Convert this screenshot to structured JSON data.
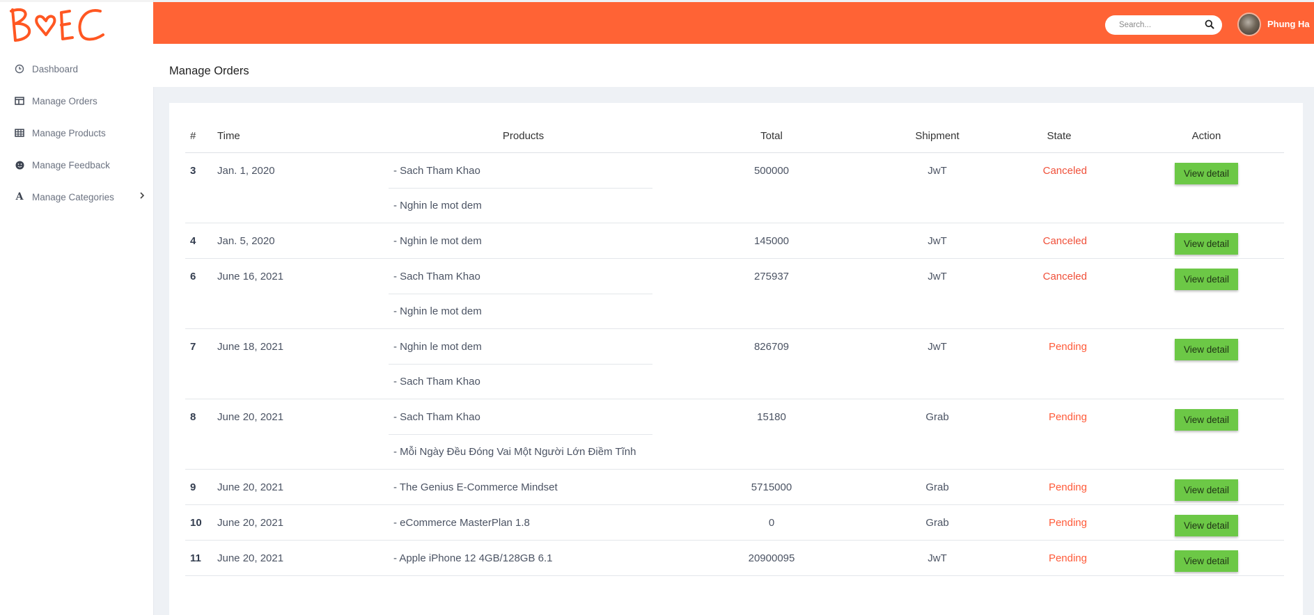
{
  "app": {
    "logo_text": "BoEC"
  },
  "sidebar": {
    "items": [
      {
        "label": "Dashboard",
        "icon": "clock-icon"
      },
      {
        "label": "Manage Orders",
        "icon": "columns-icon"
      },
      {
        "label": "Manage Products",
        "icon": "grid-icon"
      },
      {
        "label": "Manage Feedback",
        "icon": "smile-icon"
      },
      {
        "label": "Manage Categories",
        "icon": "letter-a-icon",
        "has_submenu": true
      }
    ]
  },
  "header": {
    "search_placeholder": "Search...",
    "username": "Phung Ha",
    "background_color": "#ff6335"
  },
  "page": {
    "title": "Manage Orders"
  },
  "table": {
    "columns": [
      "#",
      "Time",
      "Products",
      "Total",
      "Shipment",
      "State",
      "Action"
    ],
    "rows": [
      {
        "id": "3",
        "time": "Jan. 1, 2020",
        "products": [
          "- Sach Tham Khao",
          "- Nghin le mot dem"
        ],
        "total": "500000",
        "shipment": "JwT",
        "state": "Canceled",
        "action": "View detail"
      },
      {
        "id": "4",
        "time": "Jan. 5, 2020",
        "products": [
          "- Nghin le mot dem"
        ],
        "total": "145000",
        "shipment": "JwT",
        "state": "Canceled",
        "action": "View detail"
      },
      {
        "id": "6",
        "time": "June 16, 2021",
        "products": [
          "- Sach Tham Khao",
          "- Nghin le mot dem"
        ],
        "total": "275937",
        "shipment": "JwT",
        "state": "Canceled",
        "action": "View detail"
      },
      {
        "id": "7",
        "time": "June 18, 2021",
        "products": [
          "- Nghin le mot dem",
          "- Sach Tham Khao"
        ],
        "total": "826709",
        "shipment": "JwT",
        "state": "Pending",
        "action": "View detail"
      },
      {
        "id": "8",
        "time": "June 20, 2021",
        "products": [
          "- Sach Tham Khao",
          "- Mỗi Ngày Đều Đóng Vai Một Người Lớn Điềm Tĩnh"
        ],
        "total": "15180",
        "shipment": "Grab",
        "state": "Pending",
        "action": "View detail"
      },
      {
        "id": "9",
        "time": "June 20, 2021",
        "products": [
          "- The Genius E-Commerce Mindset"
        ],
        "total": "5715000",
        "shipment": "Grab",
        "state": "Pending",
        "action": "View detail"
      },
      {
        "id": "10",
        "time": "June 20, 2021",
        "products": [
          "- eCommerce MasterPlan 1.8"
        ],
        "total": "0",
        "shipment": "Grab",
        "state": "Pending",
        "action": "View detail"
      },
      {
        "id": "11",
        "time": "June 20, 2021",
        "products": [
          "- Apple iPhone 12 4GB/128GB 6.1"
        ],
        "total": "20900095",
        "shipment": "JwT",
        "state": "Pending",
        "action": "View detail"
      }
    ]
  },
  "colors": {
    "accent": "#ff6335",
    "canceled": "#f0503a",
    "pending": "#ff5b3a",
    "button": "#6cc846"
  }
}
